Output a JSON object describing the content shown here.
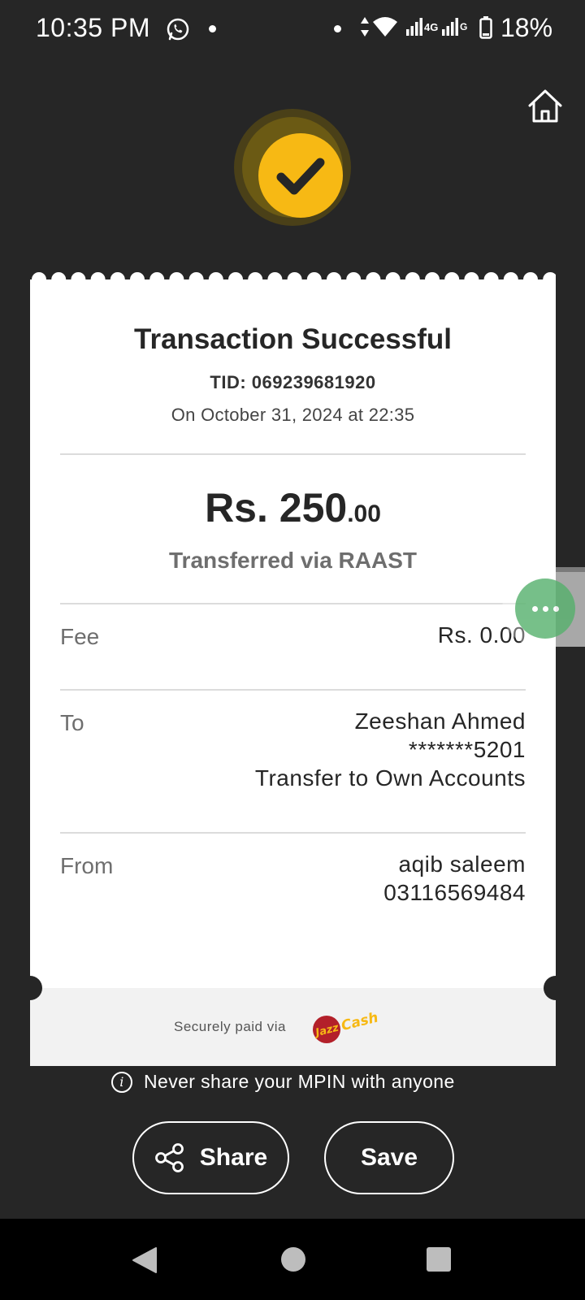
{
  "status_bar": {
    "time": "10:35 PM",
    "network_label": "4G",
    "battery_percent": "18%"
  },
  "receipt": {
    "title": "Transaction Successful",
    "tid": "TID: 069239681920",
    "date": "On October 31, 2024 at 22:35",
    "amount_main": "Rs. 250",
    "amount_cents": ".00",
    "transfer_method": "Transferred via RAAST",
    "fee_label": "Fee",
    "fee_value": "Rs. 0.00",
    "to_label": "To",
    "to_name": "Zeeshan Ahmed",
    "to_account": "*******5201",
    "to_type": "Transfer to Own Accounts",
    "from_label": "From",
    "from_name": "aqib saleem",
    "from_phone": "03116569484",
    "secure_text": "Securely paid via",
    "brand_logo": "JazzCash"
  },
  "note": {
    "text": "Never share your MPIN with anyone",
    "icon": "info-icon"
  },
  "actions": {
    "share_label": "Share",
    "save_label": "Save"
  },
  "colors": {
    "background": "#262626",
    "accent": "#f7b914",
    "float_button": "#55b06c"
  }
}
